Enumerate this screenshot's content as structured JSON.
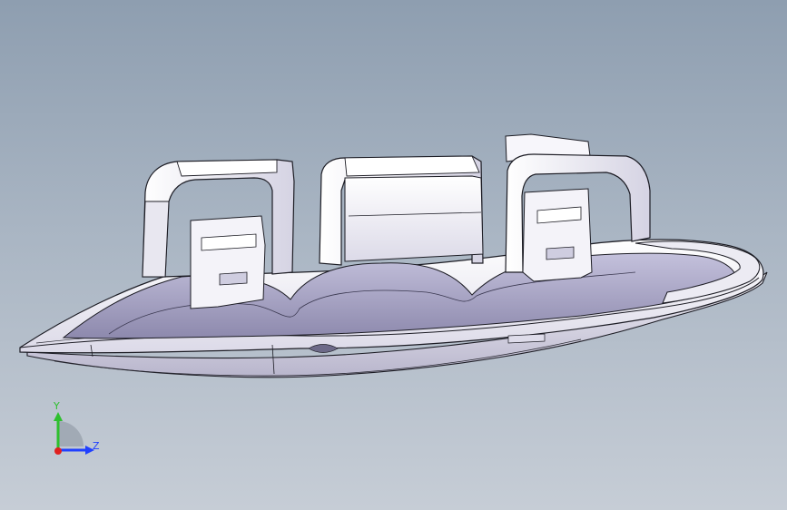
{
  "viewport": {
    "name": "3d-graphics-area",
    "background_top": "#8e9eb0",
    "background_bottom": "#c6cdd6"
  },
  "model": {
    "name": "plastic-housing-part",
    "body_color": "#f2f0f6",
    "shade_color": "#9f9bbd",
    "edge_color": "#1c1c24"
  },
  "triad": {
    "y_label": "Y",
    "z_label": "Z",
    "y_color": "#2ec02e",
    "z_color": "#2040ff",
    "x_color": "#e02020"
  }
}
